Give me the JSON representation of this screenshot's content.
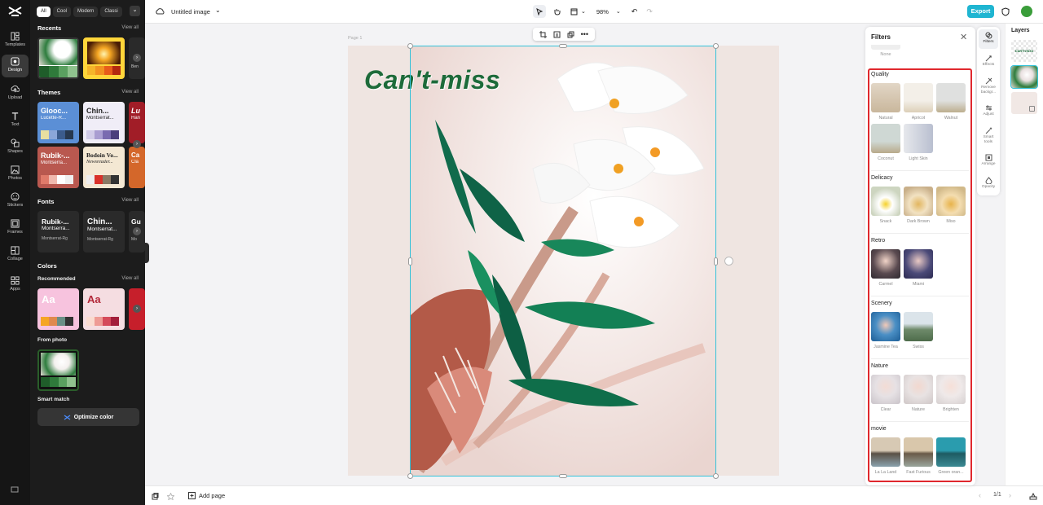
{
  "rail": {
    "items": [
      {
        "label": "Templates",
        "icon": "templates-icon"
      },
      {
        "label": "Design",
        "icon": "design-icon",
        "active": true
      },
      {
        "label": "Upload",
        "icon": "upload-icon"
      },
      {
        "label": "Text",
        "icon": "text-icon"
      },
      {
        "label": "Shapes",
        "icon": "shapes-icon"
      },
      {
        "label": "Photos",
        "icon": "photos-icon"
      },
      {
        "label": "Stickers",
        "icon": "stickers-icon"
      },
      {
        "label": "Frames",
        "icon": "frames-icon"
      },
      {
        "label": "Collage",
        "icon": "collage-icon"
      },
      {
        "label": "Apps",
        "icon": "apps-icon"
      }
    ]
  },
  "panel": {
    "chips": [
      "All",
      "Cool",
      "Modern",
      "Classi"
    ],
    "recents": {
      "title": "Recents",
      "view_all": "View all",
      "partial_label": "Ben"
    },
    "themes": {
      "title": "Themes",
      "view_all": "View all",
      "items": [
        {
          "title": "Glooc...",
          "sub": "Lucette-R...",
          "bg": "#5b8fd6",
          "fg": "#fff"
        },
        {
          "title": "Chin...",
          "sub": "Montserrat...",
          "bg": "#f0edf7",
          "fg": "#222"
        },
        {
          "title": "Rubik-...",
          "sub": "Montserra...",
          "bg": "#b9584f",
          "fg": "#fff"
        },
        {
          "title": "Bodoin Vo...",
          "sub": "Newsreader...",
          "bg": "#f4e8d3",
          "fg": "#222"
        }
      ],
      "partial": [
        {
          "title": "Lu",
          "sub": "Han"
        },
        {
          "title": "Ca",
          "sub": "Cla"
        }
      ]
    },
    "fonts": {
      "title": "Fonts",
      "view_all": "View all",
      "items": [
        {
          "f1": "Rubik-...",
          "f2": "Montserra...",
          "f3": "Montserrat-Rg"
        },
        {
          "f1": "Chin...",
          "f2": "Montserrat...",
          "f3": "Montserrat-Rg"
        }
      ],
      "partial": {
        "f1": "Gu",
        "f3": "Mo"
      }
    },
    "colors": {
      "title": "Colors",
      "recommended": "Recommended",
      "view_all": "View all",
      "aa": "Aa",
      "from_photo": "From photo",
      "smart_match": "Smart match",
      "optimize": "Optimize color"
    }
  },
  "topbar": {
    "title": "Untitled image",
    "zoom": "98%",
    "export": "Export"
  },
  "canvas": {
    "page_label": "Page 1",
    "headline": "Can't-miss"
  },
  "bottombar": {
    "add_page": "Add page",
    "page_count": "1/1"
  },
  "filters": {
    "title": "Filters",
    "none": "None",
    "categories": [
      {
        "name": "Quality",
        "items": [
          "Natural",
          "Apricot",
          "Walnut",
          "Coconut",
          "Light Skin"
        ]
      },
      {
        "name": "Delicacy",
        "items": [
          "Snack",
          "Dark Brown",
          "Miso"
        ]
      },
      {
        "name": "Retro",
        "items": [
          "Carmel",
          "Miami"
        ]
      },
      {
        "name": "Scenery",
        "items": [
          "Jasmine Tea",
          "Swiss"
        ]
      },
      {
        "name": "Nature",
        "items": [
          "Clear",
          "Nature",
          "Brighten"
        ]
      },
      {
        "name": "movie",
        "items": [
          "La La Land",
          "Fast Furious",
          "Green oran..."
        ]
      }
    ]
  },
  "right_tabs": [
    {
      "label": "Filters",
      "icon": "filters-icon",
      "active": true
    },
    {
      "label": "Effects",
      "icon": "effects-icon"
    },
    {
      "label": "Remove backgr...",
      "icon": "remove-background-icon"
    },
    {
      "label": "Adjust",
      "icon": "adjust-icon"
    },
    {
      "label": "Smart tools",
      "icon": "smart-tools-icon"
    },
    {
      "label": "Arrange",
      "icon": "arrange-icon"
    },
    {
      "label": "Opacity",
      "icon": "opacity-icon"
    }
  ],
  "layers": {
    "title": "Layers",
    "text_layer": "Can't-miss"
  },
  "colors": {
    "accent": "#1fb5d1",
    "selection": "#34c2d9",
    "highlight": "#e0282e",
    "headline": "#1d6b3a"
  }
}
